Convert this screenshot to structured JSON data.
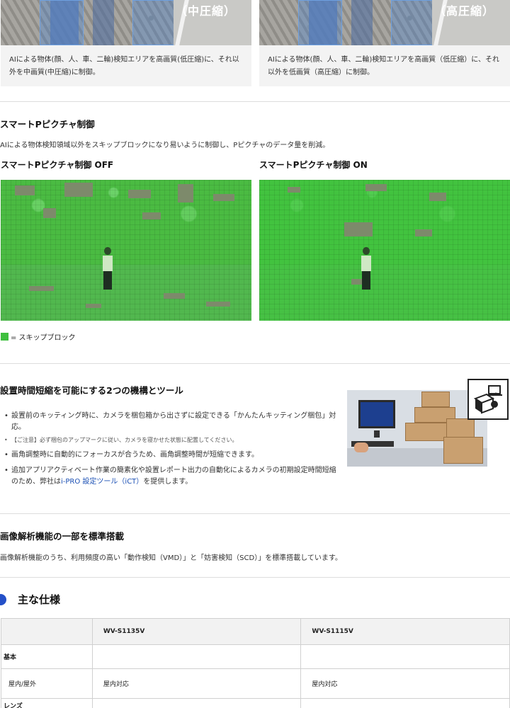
{
  "compression": {
    "left": {
      "badge": "（中圧縮）",
      "desc": "AIによる物体(顔、人、車、二輪)検知エリアを高画質(低圧縮)に、それ以外を中画質(中圧縮)に制御。"
    },
    "right": {
      "badge": "（高圧縮）",
      "desc": "AIによる物体(顔、人、車、二輪)検知エリアを高画質（低圧縮）に、それ以外を低画質（高圧縮）に制御。"
    }
  },
  "smart_p": {
    "title": "スマートPピクチャ制御",
    "text": "AIによる物体検知領域以外をスキップブロックになり易いように制御し、Pピクチャのデータ量を削減。",
    "off_label": "スマートPピクチャ制御 OFF",
    "on_label": "スマートPピクチャ制御 ON",
    "legend": "= スキップブロック",
    "skip_color": "#3fbf3f"
  },
  "tools": {
    "title": "設置時間短縮を可能にする2つの機構とツール",
    "bullet1": "設置前のキッティング時に、カメラを梱包箱から出さずに設定できる「かんたんキッティング梱包」対応。",
    "note": "【ご注意】必ず梱包のアップマークに従い、カメラを寝かせた状態に配置してください。",
    "bullet2": "画角調整時に自動的にフォーカスが合うため、画角調整時間が短縮できます。",
    "bullet3_a": "追加アプリアクティベート作業の簡素化や設置レポート出力の自動化によるカメラの初期設定時間短縮のため、弊社は",
    "bullet3_link": "i-PRO 設定ツール（iCT）",
    "bullet3_b": "を提供します。",
    "icon": "camera-box-laptop-icon"
  },
  "analysis": {
    "title": "画像解析機能の一部を標準搭載",
    "text": "画像解析機能のうち、利用頻度の高い「動作検知（VMD）」と「妨害検知（SCD）」を標準搭載しています。"
  },
  "spec": {
    "title": "主な仕様",
    "accent": "#2450c8",
    "columns": [
      "",
      "WV-S1135V",
      "WV-S1115V"
    ],
    "category_basic": "基本",
    "rows": [
      {
        "label": "屋内/屋外",
        "values": [
          "屋内対応",
          "屋内対応"
        ]
      }
    ],
    "next_category": "レンズ"
  }
}
